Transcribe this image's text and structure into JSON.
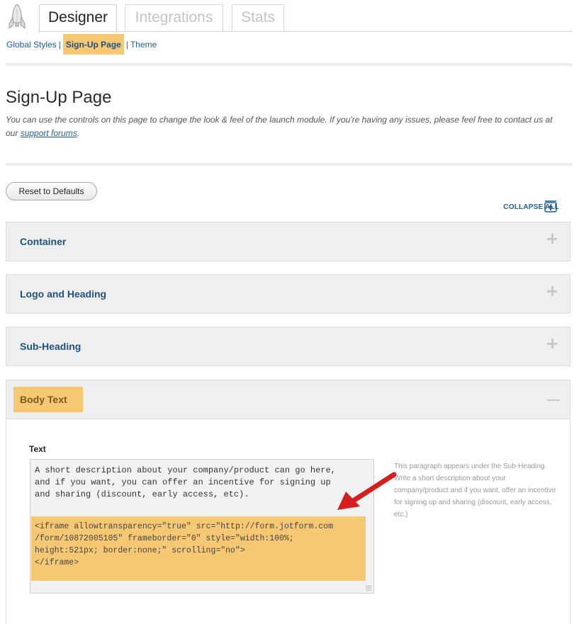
{
  "tabs": [
    {
      "label": "Designer",
      "active": true
    },
    {
      "label": "Integrations",
      "active": false
    },
    {
      "label": "Stats",
      "active": false
    }
  ],
  "subnav": {
    "global_styles": "Global Styles",
    "sep1": "|",
    "signup_page": "Sign-Up Page",
    "sep2": "|",
    "theme": "Theme"
  },
  "page": {
    "title": "Sign-Up Page",
    "intro_text": "You can use the controls on this page to change the look & feel of the launch module. If you're having any issues, please feel free to contact us at our",
    "intro_link": "support forums",
    "intro_end": "."
  },
  "toolbar": {
    "reset_label": "Reset to Defaults",
    "collapse_label": "COLLAPSE ALL"
  },
  "panels": [
    {
      "label": "Container",
      "expanded": false
    },
    {
      "label": "Logo and Heading",
      "expanded": false
    },
    {
      "label": "Sub-Heading",
      "expanded": false
    },
    {
      "label": "Body Text",
      "expanded": true
    }
  ],
  "body_text": {
    "field_label": "Text",
    "value_text": "A short description about your company/product can go here,\nand if you want, you can offer an incentive for signing up\nand sharing (discount, early access, etc).",
    "value_code": "<iframe allowtransparency=\"true\" src=\"http://form.jotform.com\n/form/10872005105\" frameborder=\"0\" style=\"width:100%;\nheight:521px; border:none;\" scrolling=\"no\">\n</iframe>",
    "help": "This paragraph appears under the Sub-Heading. Write a short description about your company/product and if you want, offer an incentive for signing up and sharing (discount, early access, etc.)"
  },
  "colors": {
    "highlight": "#f7c873",
    "link": "#1f5f9e",
    "panel_bg": "#efefef",
    "arrow": "#e02020"
  },
  "icons": {
    "logo": "rocket-icon",
    "collapse": "collapse-all-icon",
    "expand": "plus-icon",
    "collapse_panel": "minus-icon"
  }
}
